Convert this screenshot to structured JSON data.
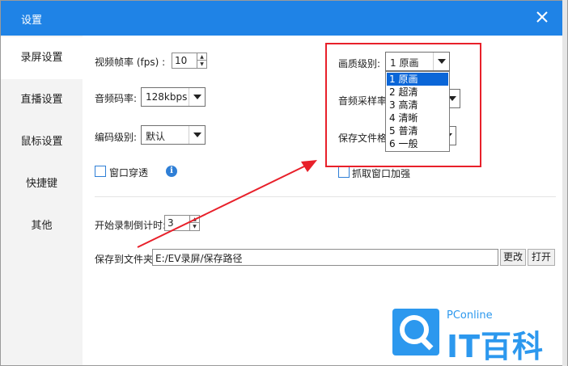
{
  "window": {
    "title": "设置"
  },
  "sidebar": {
    "items": [
      {
        "label": "录屏设置"
      },
      {
        "label": "直播设置"
      },
      {
        "label": "鼠标设置"
      },
      {
        "label": "快捷键"
      },
      {
        "label": "其他"
      }
    ]
  },
  "video": {
    "fps_label": "视频帧率 (fps) :",
    "fps_value": "10",
    "bitrate_label": "音频码率:",
    "bitrate_value": "128kbps",
    "encode_label": "编码级别:",
    "encode_value": "默认",
    "window_through_label": "窗口穿透"
  },
  "right": {
    "quality_label": "画质级别:",
    "quality_value": "1 原画",
    "sample_label": "音频采样率",
    "save_format_label": "保存文件格",
    "capture_window_label": "抓取窗口加强"
  },
  "dropdown": {
    "options": [
      "1 原画",
      "2 超清",
      "3 高清",
      "4 清晰",
      "5 普清",
      "6 一般"
    ]
  },
  "countdown": {
    "label": "开始录制倒计时:",
    "value": "3"
  },
  "save": {
    "label": "保存到文件夹:",
    "path": "E:/EV录屏/保存路径",
    "change": "更改",
    "open": "打开"
  },
  "watermark": {
    "brand": "PConline",
    "name": "IT百科"
  },
  "colors": {
    "titlebar": "#1f83e6",
    "highlight": "#e8202a",
    "selection": "#0a66d8",
    "logo": "#2c98ee"
  }
}
